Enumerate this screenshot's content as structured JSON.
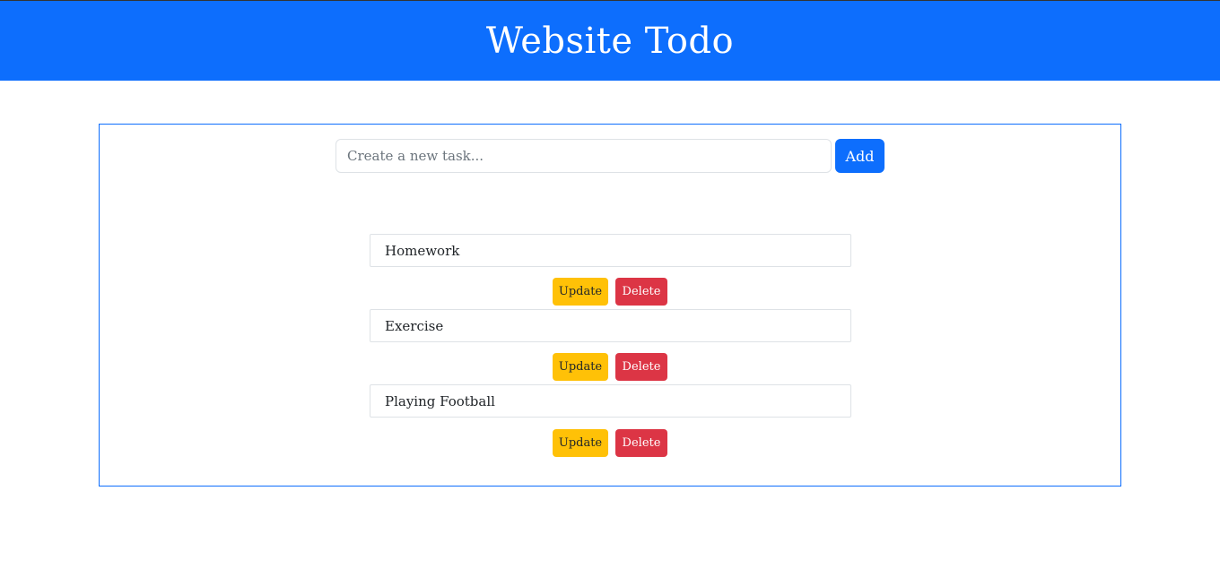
{
  "header": {
    "title": "Website Todo"
  },
  "form": {
    "placeholder": "Create a new task...",
    "add_label": "Add"
  },
  "tasks": [
    {
      "label": "Homework",
      "update_label": "Update",
      "delete_label": "Delete"
    },
    {
      "label": "Exercise",
      "update_label": "Update",
      "delete_label": "Delete"
    },
    {
      "label": "Playing Football",
      "update_label": "Update",
      "delete_label": "Delete"
    }
  ],
  "colors": {
    "primary": "#0d6efd",
    "warning": "#ffc107",
    "danger": "#dc3545"
  }
}
